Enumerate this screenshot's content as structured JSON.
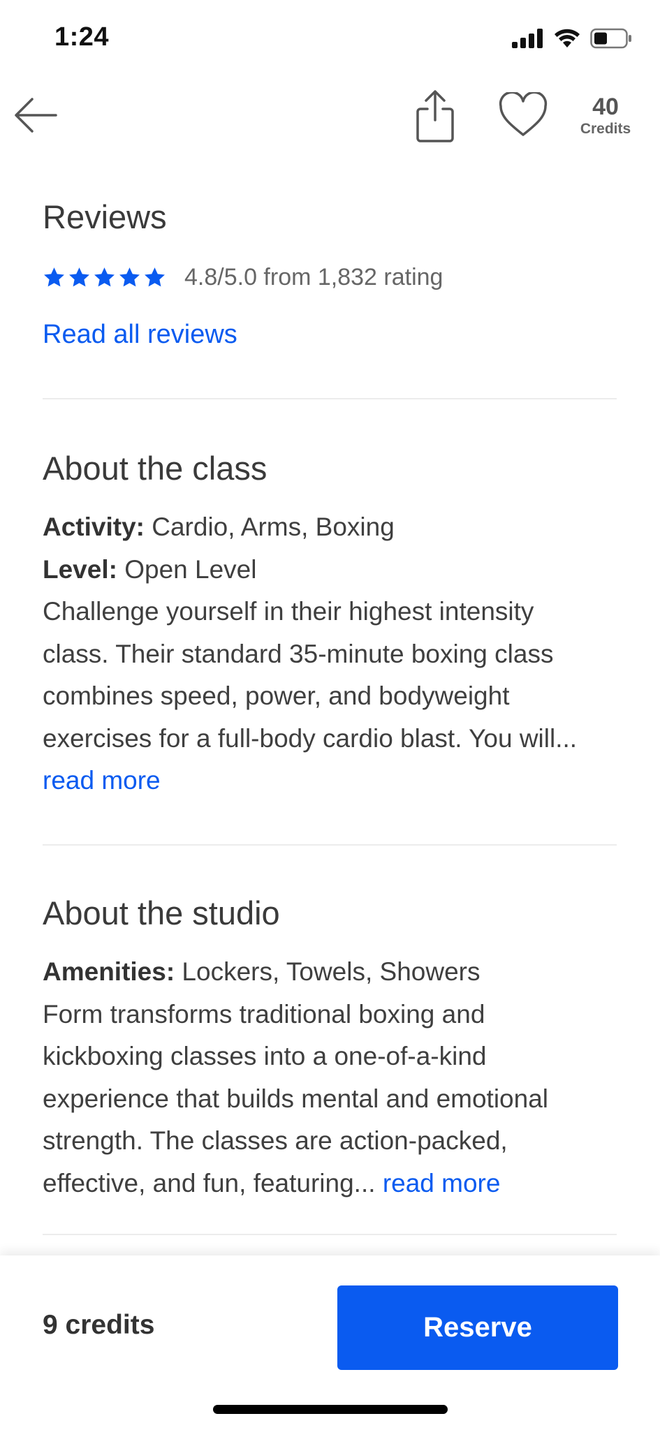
{
  "status_bar": {
    "time": "1:24"
  },
  "header": {
    "credits_value": "40",
    "credits_label": "Credits"
  },
  "reviews": {
    "title": "Reviews",
    "stars": 5,
    "rating_text": "4.8/5.0 from 1,832 rating",
    "read_all_link": "Read all reviews"
  },
  "about_class": {
    "title": "About the class",
    "activity_label": "Activity:",
    "activity_value": " Cardio, Arms, Boxing",
    "level_label": "Level:",
    "level_value": " Open Level",
    "description_lines": [
      "Challenge yourself in their highest intensity",
      "class. Their standard 35-minute boxing class",
      "combines speed, power, and bodyweight",
      "exercises for a full-body cardio blast. You will..."
    ],
    "read_more": "read more"
  },
  "about_studio": {
    "title": "About the studio",
    "amenities_label": "Amenities:",
    "amenities_value": " Lockers, Towels, Showers",
    "description_lines": [
      "Form transforms traditional boxing and",
      "kickboxing classes into a one-of-a-kind",
      "experience that builds mental and emotional",
      "strength. The classes are action-packed,",
      "effective, and fun, featuring... "
    ],
    "read_more": "read more"
  },
  "footer": {
    "price": "9 credits",
    "reserve_label": "Reserve"
  },
  "colors": {
    "accent": "#0a5bf0",
    "text": "#333333",
    "muted": "#666666",
    "divider": "#ececec"
  },
  "icons": {
    "back": "arrow-left-icon",
    "share": "share-icon",
    "favorite": "heart-icon",
    "star": "star-icon",
    "signal": "cellular-signal-icon",
    "wifi": "wifi-icon",
    "battery": "battery-icon"
  }
}
